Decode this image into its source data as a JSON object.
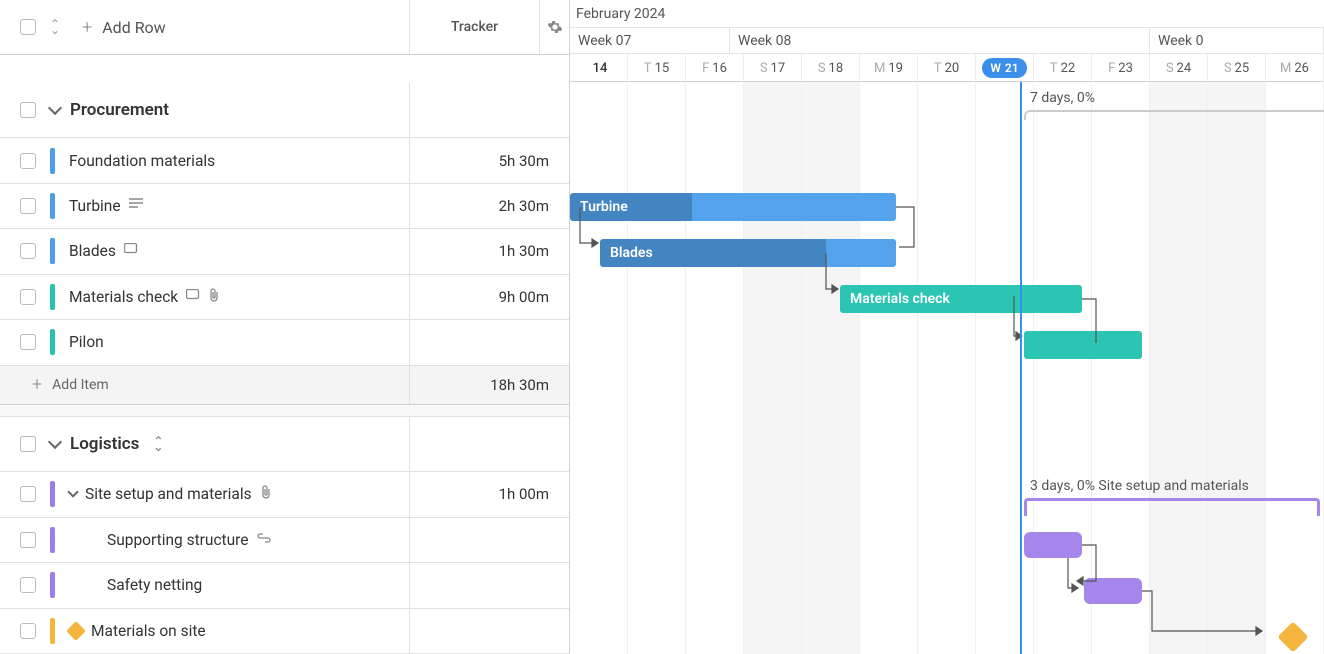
{
  "header": {
    "add_row_label": "Add Row",
    "tracker_label": "Tracker",
    "month_label": "February 2024",
    "weeks": [
      "Week 07",
      "Week 08",
      "Week 0"
    ],
    "days": [
      {
        "dow": "",
        "num": "14",
        "first": true
      },
      {
        "dow": "T",
        "num": "15"
      },
      {
        "dow": "F",
        "num": "16"
      },
      {
        "dow": "S",
        "num": "17",
        "weekend": true
      },
      {
        "dow": "S",
        "num": "18",
        "weekend": true
      },
      {
        "dow": "M",
        "num": "19"
      },
      {
        "dow": "T",
        "num": "20"
      },
      {
        "dow": "W",
        "num": "21",
        "today": true
      },
      {
        "dow": "T",
        "num": "22"
      },
      {
        "dow": "F",
        "num": "23"
      },
      {
        "dow": "S",
        "num": "24",
        "weekend": true
      },
      {
        "dow": "S",
        "num": "25",
        "weekend": true
      },
      {
        "dow": "M",
        "num": "26"
      }
    ]
  },
  "groups": [
    {
      "name": "Procurement",
      "total": "18h 30m",
      "add_item_label": "Add Item",
      "rows": [
        {
          "label": "Foundation materials",
          "tracker": "5h 30m",
          "color": "blue"
        },
        {
          "label": "Turbine",
          "tracker": "2h 30m",
          "color": "blue",
          "icons": [
            "desc"
          ]
        },
        {
          "label": "Blades",
          "tracker": "1h 30m",
          "color": "blue",
          "icons": [
            "comment"
          ]
        },
        {
          "label": "Materials check",
          "tracker": "9h 00m",
          "color": "teal",
          "icons": [
            "comment",
            "attach"
          ]
        },
        {
          "label": "Pilon",
          "tracker": "",
          "color": "teal"
        }
      ]
    },
    {
      "name": "Logistics",
      "rows": [
        {
          "label": "Site setup and materials",
          "tracker": "1h 00m",
          "color": "purple",
          "expandable": true,
          "icons": [
            "attach"
          ]
        },
        {
          "label": "Supporting structure",
          "color": "purple",
          "indent": 1,
          "icons": [
            "link"
          ]
        },
        {
          "label": "Safety netting",
          "color": "purple",
          "indent": 1
        },
        {
          "label": "Materials on site",
          "color": "amber",
          "milestone": true
        }
      ]
    }
  ],
  "gantt": {
    "bars": {
      "turbine": "Turbine",
      "blades": "Blades",
      "materials_check": "Materials check"
    },
    "summaries": {
      "logistics": "7 days, 0%",
      "site_setup": "3 days, 0% Site setup and materials"
    }
  }
}
